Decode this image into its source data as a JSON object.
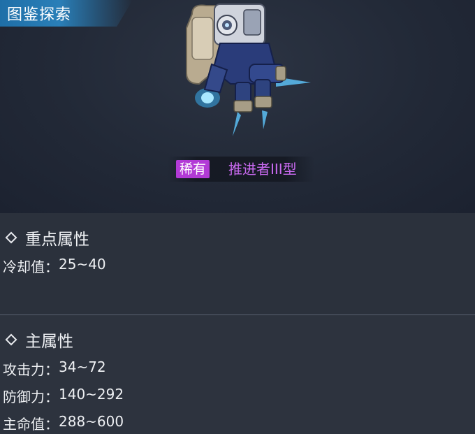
{
  "header": {
    "title": "图鉴探索"
  },
  "item": {
    "rarity": "稀有",
    "name": "推进者III型",
    "rarity_color": "#b23ad6",
    "name_color": "#c96af0"
  },
  "key_attributes": {
    "title": "重点属性",
    "stats": [
      {
        "label": "冷却值：",
        "value": "25~40"
      }
    ]
  },
  "main_attributes": {
    "title": "主属性",
    "stats": [
      {
        "label": "攻击力：",
        "value": "34~72"
      },
      {
        "label": "防御力：",
        "value": "140~292"
      },
      {
        "label": "主命值：",
        "value": "288~600"
      }
    ]
  },
  "accent_color": "#2a7fb8",
  "icons": [
    "diamond-icon",
    "mech-illustration"
  ]
}
